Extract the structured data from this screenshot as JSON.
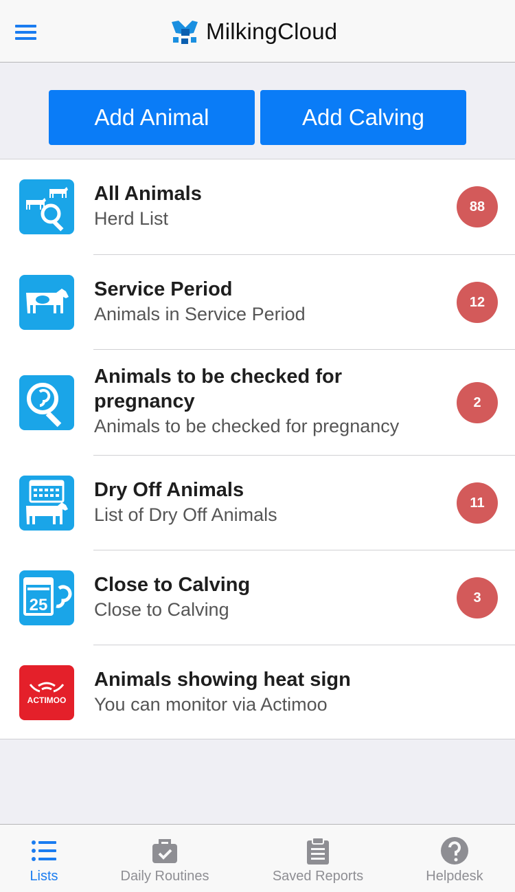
{
  "header": {
    "app_name": "MilkingCloud"
  },
  "actions": {
    "add_animal": "Add Animal",
    "add_calving": "Add Calving"
  },
  "list": [
    {
      "title": "All Animals",
      "subtitle": "Herd List",
      "badge": "88",
      "icon": "herd-search-icon"
    },
    {
      "title": "Service Period",
      "subtitle": "Animals in Service Period",
      "badge": "12",
      "icon": "cow-icon"
    },
    {
      "title": "Animals to be checked for pregnancy",
      "subtitle": "Animals to be checked for pregnancy",
      "badge": "2",
      "icon": "pregnancy-search-icon"
    },
    {
      "title": "Dry Off Animals",
      "subtitle": "List of Dry Off Animals",
      "badge": "11",
      "icon": "calendar-cow-icon"
    },
    {
      "title": "Close to Calving",
      "subtitle": "Close to Calving",
      "badge": "3",
      "icon": "calendar-calf-icon",
      "calendar_day": "25"
    },
    {
      "title": "Animals showing heat sign",
      "subtitle": "You can monitor via Actimoo",
      "icon": "actimoo-logo-icon",
      "logo_text": "ACTIMOO"
    }
  ],
  "tabs": [
    {
      "label": "Lists",
      "icon": "list-icon",
      "active": true
    },
    {
      "label": "Daily Routines",
      "icon": "briefcase-check-icon",
      "active": false
    },
    {
      "label": "Saved Reports",
      "icon": "clipboard-icon",
      "active": false
    },
    {
      "label": "Helpdesk",
      "icon": "help-circle-icon",
      "active": false
    }
  ],
  "colors": {
    "primary": "#0a7cf7",
    "badge": "#d35a5a",
    "icon_tile": "#1aa5e8",
    "actimoo_red": "#e4202a",
    "tab_active": "#1a7cf0",
    "tab_inactive": "#8e8e93"
  }
}
